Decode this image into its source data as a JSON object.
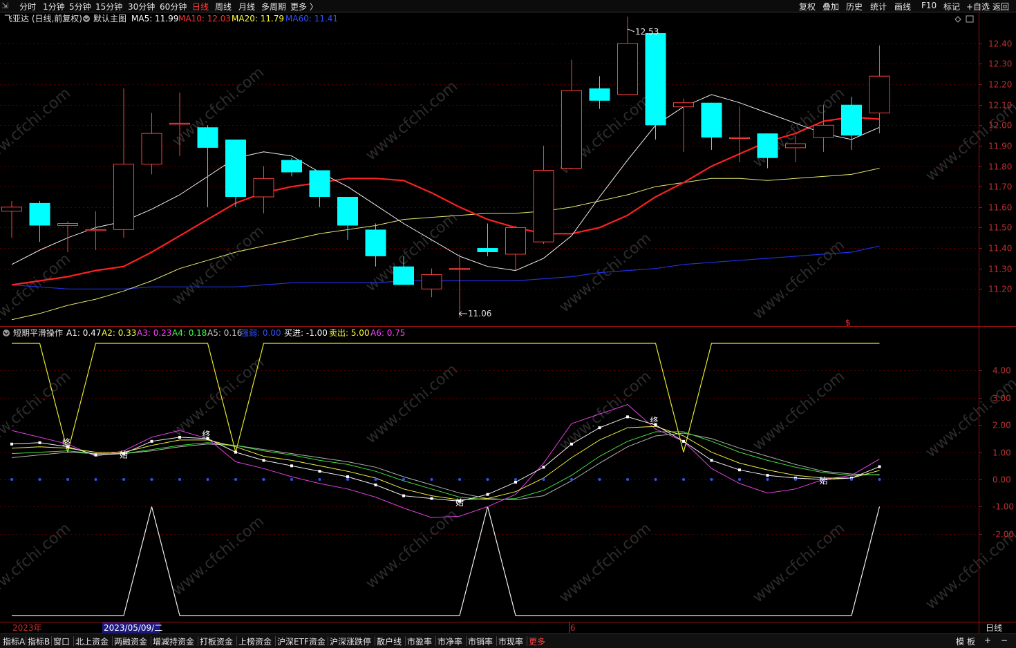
{
  "topbar": {
    "left_items": [
      "分时",
      "1分钟",
      "5分钟",
      "15分钟",
      "30分钟",
      "60分钟",
      "日线",
      "周线",
      "月线",
      "多周期",
      "更多 〉"
    ],
    "active": "日线",
    "right_items": [
      "复权",
      "叠加",
      "历史",
      "统计",
      "画线",
      "F10",
      "标记",
      "+自选",
      "返回"
    ]
  },
  "main_panel": {
    "title": "飞亚达 (日线,前复权)",
    "template": "默认主图",
    "ma": [
      {
        "label": "MA5: 11.99",
        "color": "#ffffff"
      },
      {
        "label": "MA10: 12.03",
        "color": "#ff3030"
      },
      {
        "label": "MA20: 11.79",
        "color": "#ffff40"
      },
      {
        "label": "MA60: 11.41",
        "color": "#3050ff"
      }
    ],
    "high_label": "12.53",
    "low_label": "11.06",
    "marker": "$",
    "y_ticks": [
      "12.40",
      "12.30",
      "12.20",
      "12.10",
      "12.00",
      "11.90",
      "11.80",
      "11.70",
      "11.60",
      "11.50",
      "11.40",
      "11.30",
      "11.20"
    ]
  },
  "sub_panel": {
    "title": "短期平滑操作",
    "indicators": [
      {
        "label": "A1: 0.47",
        "color": "#ffffff"
      },
      {
        "label": "A2: 0.33",
        "color": "#ffff40"
      },
      {
        "label": "A3: 0.23",
        "color": "#ff40ff"
      },
      {
        "label": "A4: 0.18",
        "color": "#40ff40"
      },
      {
        "label": "A5: 0.16",
        "color": "#cccccc"
      },
      {
        "label": "强弱: 0.00",
        "color": "#3050ff"
      },
      {
        "label": "买进: -1.00",
        "color": "#ffffff"
      },
      {
        "label": "卖出: 5.00",
        "color": "#ffff40"
      },
      {
        "label": "A6: 0.75",
        "color": "#ff40ff"
      }
    ],
    "y_ticks": [
      "4.00",
      "3.00",
      "2.00",
      "1.00",
      "0.00",
      "-1.00",
      "-2.00"
    ],
    "signals": {
      "end": "终",
      "start": "始"
    }
  },
  "date_axis": {
    "left": "2023年",
    "cursor": "2023/05/09/二",
    "mark": "6",
    "period": "日线"
  },
  "watermark": "www.cfchi.com",
  "bottombar": {
    "items": [
      "指标A",
      "指标B",
      "窗口",
      "北上资金",
      "两融资金",
      "增减持资金",
      "打板资金",
      "上榜资金",
      "沪深ETF资金",
      "沪深涨跌停",
      "散户线",
      "市盈率",
      "市净率",
      "市销率",
      "市现率",
      "更多"
    ],
    "highlight": "更多",
    "right_items": [
      "模",
      "板",
      "+",
      "−"
    ]
  },
  "chart_data": {
    "type": "candlestick",
    "candles": [
      [
        11.58,
        11.6,
        11.63,
        11.45
      ],
      [
        11.62,
        11.51,
        11.63,
        11.43
      ],
      [
        11.51,
        11.52,
        11.53,
        11.38
      ],
      [
        11.49,
        11.49,
        11.58,
        11.39
      ],
      [
        11.49,
        11.81,
        12.18,
        11.45
      ],
      [
        11.81,
        11.96,
        12.06,
        11.76
      ],
      [
        12.01,
        12.01,
        12.16,
        11.85
      ],
      [
        11.99,
        11.89,
        12.0,
        11.6
      ],
      [
        11.93,
        11.65,
        11.93,
        11.6
      ],
      [
        11.65,
        11.74,
        11.8,
        11.57
      ],
      [
        11.83,
        11.77,
        11.84,
        11.75
      ],
      [
        11.78,
        11.65,
        11.78,
        11.6
      ],
      [
        11.65,
        11.51,
        11.65,
        11.44
      ],
      [
        11.49,
        11.36,
        11.52,
        11.31
      ],
      [
        11.31,
        11.22,
        11.36,
        11.22
      ],
      [
        11.2,
        11.27,
        11.3,
        11.16
      ],
      [
        11.3,
        11.3,
        11.37,
        11.06
      ],
      [
        11.4,
        11.38,
        11.52,
        11.36
      ],
      [
        11.37,
        11.5,
        11.51,
        11.29
      ],
      [
        11.43,
        11.78,
        11.9,
        11.42
      ],
      [
        11.79,
        12.17,
        12.32,
        11.79
      ],
      [
        12.18,
        12.12,
        12.24,
        12.08
      ],
      [
        12.15,
        12.4,
        12.53,
        12.16
      ],
      [
        12.45,
        12.0,
        12.45,
        11.93
      ],
      [
        12.09,
        12.11,
        12.13,
        11.87
      ],
      [
        12.11,
        11.94,
        12.11,
        11.88
      ],
      [
        11.94,
        11.94,
        12.09,
        11.82
      ],
      [
        11.96,
        11.84,
        11.96,
        11.79
      ],
      [
        11.89,
        11.91,
        11.95,
        11.82
      ],
      [
        11.94,
        12.0,
        12.1,
        11.87
      ],
      [
        12.1,
        11.95,
        12.14,
        11.88
      ],
      [
        12.06,
        12.24,
        12.39,
        11.96
      ]
    ],
    "ma5": [
      11.32,
      11.39,
      11.45,
      11.5,
      11.53,
      11.59,
      11.66,
      11.75,
      11.84,
      11.87,
      11.85,
      11.77,
      11.7,
      11.61,
      11.52,
      11.44,
      11.36,
      11.31,
      11.29,
      11.35,
      11.46,
      11.65,
      11.83,
      12.0,
      12.09,
      12.15,
      12.11,
      12.06,
      12.01,
      11.96,
      11.93,
      11.99
    ],
    "ma10": [
      11.22,
      11.24,
      11.26,
      11.29,
      11.31,
      11.38,
      11.46,
      11.54,
      11.62,
      11.67,
      11.7,
      11.72,
      11.74,
      11.74,
      11.73,
      11.67,
      11.6,
      11.54,
      11.5,
      11.47,
      11.47,
      11.5,
      11.56,
      11.65,
      11.72,
      11.8,
      11.86,
      11.92,
      11.96,
      12.02,
      12.04,
      12.03
    ],
    "ma20": [
      11.05,
      11.08,
      11.12,
      11.15,
      11.19,
      11.24,
      11.3,
      11.34,
      11.38,
      11.41,
      11.44,
      11.47,
      11.49,
      11.51,
      11.54,
      11.55,
      11.56,
      11.57,
      11.57,
      11.58,
      11.6,
      11.63,
      11.66,
      11.7,
      11.72,
      11.74,
      11.74,
      11.73,
      11.74,
      11.75,
      11.76,
      11.79
    ],
    "ma60": [
      11.22,
      11.21,
      11.2,
      11.2,
      11.2,
      11.21,
      11.21,
      11.21,
      11.21,
      11.22,
      11.23,
      11.23,
      11.23,
      11.23,
      11.24,
      11.24,
      11.24,
      11.24,
      11.24,
      11.25,
      11.26,
      11.28,
      11.29,
      11.3,
      11.32,
      11.33,
      11.34,
      11.35,
      11.36,
      11.37,
      11.38,
      11.41
    ],
    "sub": {
      "sell": [
        5,
        5,
        1,
        5,
        5,
        5,
        5,
        5,
        1,
        5,
        5,
        5,
        5,
        5,
        5,
        5,
        5,
        5,
        5,
        5,
        5,
        5,
        5,
        5,
        1,
        5,
        5,
        5,
        5,
        5,
        5,
        5
      ],
      "buy": [
        -5,
        -5,
        -5,
        -5,
        -5,
        -1,
        -5,
        -5,
        -5,
        -5,
        -5,
        -5,
        -5,
        -5,
        -5,
        -5,
        -5,
        -1,
        -5,
        -5,
        -5,
        -5,
        -5,
        -5,
        -5,
        -5,
        -5,
        -5,
        -5,
        -5,
        -5,
        -1
      ],
      "a1": [
        1.3,
        1.35,
        1.2,
        0.9,
        0.95,
        1.4,
        1.55,
        1.5,
        1.0,
        0.7,
        0.5,
        0.3,
        0.1,
        -0.2,
        -0.6,
        -0.7,
        -0.8,
        -0.55,
        -0.1,
        0.45,
        1.3,
        1.9,
        2.3,
        2.0,
        1.4,
        0.7,
        0.35,
        0.15,
        0.05,
        0.0,
        0.05,
        0.47
      ],
      "a2": [
        1.15,
        1.2,
        1.15,
        1.0,
        1.0,
        1.25,
        1.45,
        1.45,
        1.2,
        0.85,
        0.7,
        0.5,
        0.3,
        0.05,
        -0.35,
        -0.6,
        -0.75,
        -0.7,
        -0.45,
        0.05,
        0.8,
        1.45,
        1.9,
        1.95,
        1.6,
        1.0,
        0.6,
        0.35,
        0.15,
        0.05,
        0.05,
        0.33
      ],
      "a3": [
        1.8,
        1.55,
        1.3,
        0.85,
        1.05,
        1.55,
        1.8,
        1.5,
        0.65,
        0.4,
        0.1,
        -0.15,
        -0.35,
        -0.65,
        -1.05,
        -1.4,
        -1.35,
        -1.0,
        -0.55,
        0.6,
        2.05,
        2.4,
        2.75,
        1.85,
        1.4,
        0.4,
        -0.15,
        -0.5,
        -0.35,
        0.0,
        0.15,
        0.75
      ],
      "a4": [
        0.95,
        1.0,
        1.05,
        0.95,
        0.95,
        1.1,
        1.25,
        1.35,
        1.25,
        1.05,
        0.9,
        0.7,
        0.55,
        0.3,
        -0.05,
        -0.35,
        -0.65,
        -0.75,
        -0.7,
        -0.4,
        0.15,
        0.85,
        1.4,
        1.75,
        1.75,
        1.4,
        1.0,
        0.7,
        0.45,
        0.25,
        0.15,
        0.18
      ],
      "a5": [
        0.8,
        0.9,
        1.0,
        0.95,
        0.95,
        1.05,
        1.2,
        1.3,
        1.25,
        1.1,
        0.95,
        0.8,
        0.65,
        0.45,
        0.1,
        -0.2,
        -0.5,
        -0.7,
        -0.75,
        -0.6,
        -0.05,
        0.6,
        1.2,
        1.6,
        1.7,
        1.5,
        1.15,
        0.85,
        0.55,
        0.3,
        0.2,
        0.16
      ]
    }
  }
}
